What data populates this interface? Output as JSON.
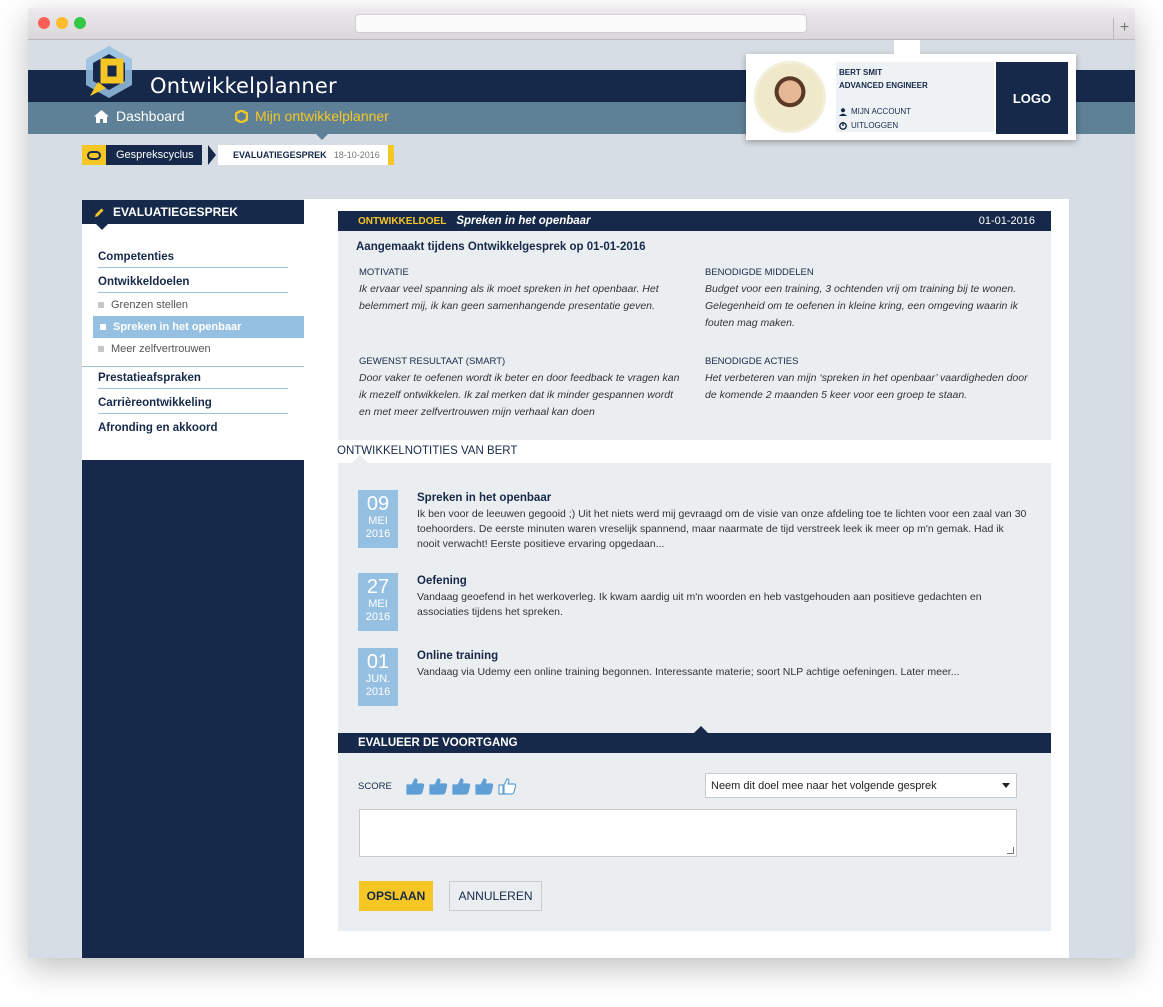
{
  "app": {
    "title": "Ontwikkelplanner"
  },
  "colors": {
    "navy": "#16294a",
    "accent": "#f5c624",
    "light_blue": "#96c0e2",
    "nav_bg": "#5f8198",
    "panel": "#ebeef0"
  },
  "nav": {
    "items": [
      {
        "label": "Dashboard",
        "icon": "home-icon",
        "active": false
      },
      {
        "label": "Mijn ontwikkelplanner",
        "icon": "cycle-icon",
        "active": true
      }
    ]
  },
  "profile": {
    "name": "BERT SMIT",
    "role": "ADVANCED ENGINEER",
    "account_label": "MIJN ACCOUNT",
    "logout_label": "UITLOGGEN",
    "logo_label": "LOGO"
  },
  "breadcrumb": {
    "cycle_label": "Gesprekscyclus",
    "current_label": "EVALUATIEGESPREK",
    "current_date": "18-10-2016"
  },
  "sidebar": {
    "heading": "EVALUATIEGESPREK",
    "items": [
      {
        "label": "Competenties"
      },
      {
        "label": "Ontwikkeldoelen"
      },
      {
        "label": "Prestatieafspraken"
      },
      {
        "label": "Carrièreontwikkeling"
      },
      {
        "label": "Afronding en akkoord"
      }
    ],
    "subitems": [
      {
        "label": "Grenzen stellen",
        "active": false
      },
      {
        "label": "Spreken in het openbaar",
        "active": true
      },
      {
        "label": "Meer zelfvertrouwen",
        "active": false
      }
    ]
  },
  "goal": {
    "kicker": "ONTWIKKELDOEL",
    "title": "Spreken in het openbaar",
    "date": "01-01-2016",
    "made_during": "Aangemaakt tijdens Ontwikkelgesprek op 01-01-2016",
    "motivation_label": "MOTIVATIE",
    "motivation": "Ik ervaar veel spanning als ik moet spreken in het openbaar. Het belemmert mij, ik kan geen samenhangende presentatie geven.",
    "resources_label": "BENODIGDE MIDDELEN",
    "resources": "Budget voor een training, 3 ochtenden vrij om training bij te wonen. Gelegenheid om te oefenen in kleine kring, een omgeving waarin ik fouten mag maken.",
    "result_label": "GEWENST RESULTAAT (SMART)",
    "result": "Door vaker te oefenen wordt ik beter en door feedback te vragen kan ik mezelf ontwikkelen. Ik zal merken dat ik minder gespannen wordt en met meer zelfvertrouwen mijn verhaal kan doen",
    "actions_label": "BENODIGDE ACTIES",
    "actions": "Het verbeteren van mijn ‘spreken in het openbaar’ vaardigheden door de komende 2 maanden 5 keer voor een groep te staan."
  },
  "notes": {
    "title": "ONTWIKKELNOTITIES VAN BERT",
    "items": [
      {
        "day": "09",
        "month": "MEI",
        "year": "2016",
        "title": "Spreken in het openbaar",
        "body": "Ik ben voor de leeuwen gegooid ;) Uit het niets werd mij gevraagd om de visie van onze afdeling toe te lichten voor een zaal van 30 toehoorders. De eerste minuten waren vreselijk spannend, maar naarmate de tijd verstreek leek ik meer op m'n gemak. Had ik nooit verwacht! Eerste positieve ervaring opgedaan..."
      },
      {
        "day": "27",
        "month": "MEI",
        "year": "2016",
        "title": "Oefening",
        "body": "Vandaag geoefend in het werkoverleg. Ik kwam aardig uit m'n woorden en heb vastgehouden aan positieve gedachten en associaties tijdens het spreken."
      },
      {
        "day": "01",
        "month": "JUN.",
        "year": "2016",
        "title": "Online training",
        "body": "Vandaag via Udemy een online training begonnen. Interessante materie; soort NLP achtige oefeningen. Later meer..."
      }
    ]
  },
  "evaluation": {
    "heading": "EVALUEER DE VOORTGANG",
    "score_label": "SCORE",
    "score_max": 5,
    "score_filled": 4,
    "select_value": "Neem dit doel mee naar het volgende gesprek",
    "textarea_value": "",
    "save_label": "OPSLAAN",
    "cancel_label": "ANNULEREN"
  }
}
